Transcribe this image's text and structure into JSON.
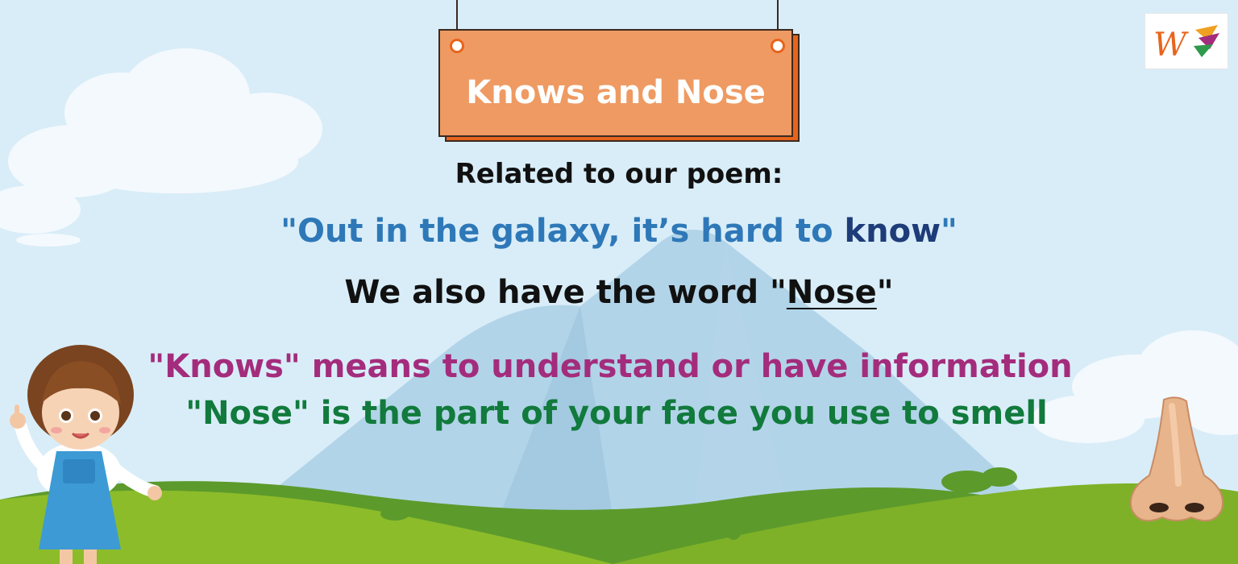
{
  "sign": {
    "title": "Knows and Nose"
  },
  "lines": {
    "related": "Related to our poem:",
    "quote_part": "\"Out in the galaxy, it’s hard to ",
    "quote_word": "know",
    "quote_end": "\"",
    "also_prefix": "We also have the word \"",
    "also_word": "Nose",
    "also_suffix": "\"",
    "knows_def": "\"Knows\" means to understand or have information",
    "nose_def": "\"Nose\" is the part of your face you use to smell"
  },
  "colors": {
    "sky": "#d9edf8",
    "sign": "#ee9a62",
    "sign_shadow": "#e8641c",
    "quote_blue": "#2e78b8",
    "quote_dark": "#1d3c78",
    "black": "#111111",
    "magenta": "#a42c7c",
    "green": "#117a3c",
    "grass": "#8cbc2a"
  },
  "icons": {
    "logo": "w-logo-icon",
    "girl": "girl-illustration",
    "nose": "nose-illustration"
  }
}
